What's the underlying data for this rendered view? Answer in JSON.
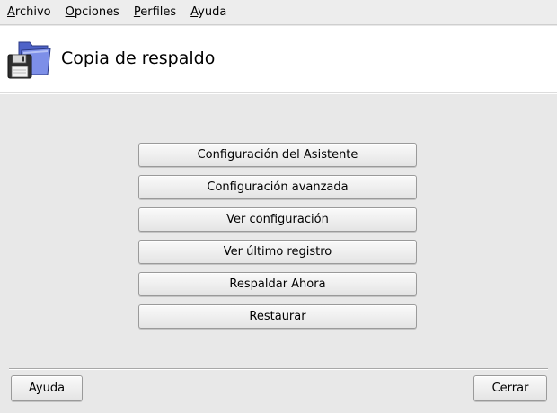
{
  "menubar": {
    "items": [
      {
        "mnemonic": "A",
        "rest": "rchivo"
      },
      {
        "mnemonic": "O",
        "rest": "pciones"
      },
      {
        "mnemonic": "P",
        "rest": "erfiles"
      },
      {
        "mnemonic": "A",
        "rest": "yuda"
      }
    ]
  },
  "header": {
    "icon": "backup-floppy-folder-icon",
    "title": "Copia de respaldo"
  },
  "actions": {
    "wizard": "Configuración del Asistente",
    "advanced": "Configuración avanzada",
    "view_config": "Ver configuración",
    "view_last_log": "Ver último registro",
    "backup_now": "Respaldar Ahora",
    "restore": "Restaurar"
  },
  "footer": {
    "help": "Ayuda",
    "close": "Cerrar"
  }
}
